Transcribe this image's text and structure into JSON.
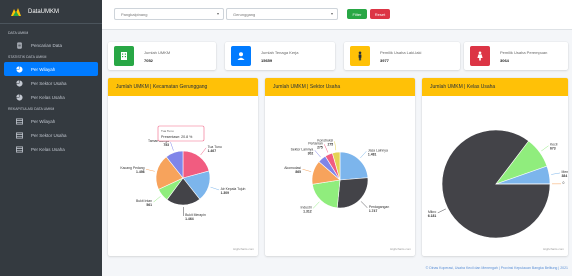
{
  "brand": {
    "name": "DataUMKM"
  },
  "sidebar": {
    "sections": [
      {
        "title": "DATA UMKM",
        "items": [
          {
            "label": "Pencarian Data",
            "icon": "file-icon"
          }
        ]
      },
      {
        "title": "STATISTIK DATA UMKM",
        "items": [
          {
            "label": "Per Wilayah",
            "icon": "pie-icon",
            "active": true
          },
          {
            "label": "Per Sektor Usaha",
            "icon": "pie-icon"
          },
          {
            "label": "Per Kelas Usaha",
            "icon": "pie-icon"
          }
        ]
      },
      {
        "title": "REKAPITULASI DATA UMKM",
        "items": [
          {
            "label": "Per Wilayah",
            "icon": "table-icon"
          },
          {
            "label": "Per Sektor Usaha",
            "icon": "table-icon"
          },
          {
            "label": "Per Kelas Usaha",
            "icon": "table-icon"
          }
        ]
      }
    ]
  },
  "filters": {
    "kabupaten": "Pangkalpinang",
    "kecamatan": "Gerunggang",
    "filter_label": "Filter",
    "reset_label": "Reset"
  },
  "cards": [
    {
      "label": "Jumlah UMKM",
      "value": "7052",
      "color": "#28a745",
      "icon": "building-icon"
    },
    {
      "label": "Jumlah Tenaga Kerja",
      "value": "15659",
      "color": "#007bff",
      "icon": "user-icon"
    },
    {
      "label": "Pemilik Usaha Laki-laki",
      "value": "3977",
      "color": "#ffc107",
      "icon": "male-icon"
    },
    {
      "label": "Pemilik Usaha Perempuan",
      "value": "3064",
      "color": "#dc3545",
      "icon": "female-icon"
    }
  ],
  "panels": [
    {
      "title": "Jumlah UMKM | Kecamatan Gerunggang"
    },
    {
      "title": "Jumlah UMKM | Sektor Usaha"
    },
    {
      "title": "Jumlah UMKM | Kelas Usaha"
    }
  ],
  "tooltip": {
    "title": "Tua Tunu",
    "text": "Presentase: 20.8 %"
  },
  "credits": "Highcharts.com",
  "footer": "© Dinas Koperasi, Usaha Kecil dan Menengah | Provinsi Kepulauan Bangka Belitung | 2021",
  "chart_data": [
    {
      "type": "pie",
      "title": "Jumlah UMKM | Kecamatan Gerunggang",
      "categories": [
        "Tua Tunu",
        "Air Kepala Tujuh",
        "Bukit Merapin",
        "Bukit Intan",
        "Kacang Pedang",
        "Taman Bunga"
      ],
      "values": [
        1467,
        1309,
        1464,
        561,
        1498,
        753
      ],
      "colors": [
        "#f15c80",
        "#7cb5ec",
        "#434348",
        "#90ed7d",
        "#f7a35c",
        "#8085e9"
      ],
      "labels": [
        "Tua Tunu\n1.467",
        "Air Kepala Tujuh\n1.309",
        "Bukit Merapin\n1.464",
        "Bukit Intan\n561",
        "Kacang Pedang\n1.498",
        "Taman Bunga\n753"
      ]
    },
    {
      "type": "pie",
      "title": "Jumlah UMKM | Sektor Usaha",
      "categories": [
        "Jasa Lainnya",
        "Perdagangan",
        "Industri",
        "Akomodasi",
        "Sektor Lainnya",
        "Pertanian",
        "Konstruksi"
      ],
      "values": [
        1481,
        1747,
        1312,
        865,
        302,
        275,
        275
      ],
      "colors": [
        "#7cb5ec",
        "#434348",
        "#90ed7d",
        "#f7a35c",
        "#8085e9",
        "#f15c80",
        "#e4d354"
      ],
      "labels": [
        "Jasa Lainnya\n1.481",
        "Perdagangan\n1.747",
        "Industri\n1.312",
        "Akomodasi\n865",
        "Sektor Lainnya\n302",
        "Pertanian\n275",
        "Konstruksi\n275"
      ]
    },
    {
      "type": "pie",
      "title": "Jumlah UMKM | Kelas Usaha",
      "categories": [
        "Mikro",
        "Kecil",
        "Menengah",
        "Besar"
      ],
      "values": [
        6181,
        673,
        384,
        5
      ],
      "colors": [
        "#434348",
        "#90ed7d",
        "#7cb5ec",
        "#f7a35c"
      ],
      "labels": [
        "Mikro\n6.181",
        "Kecil\n673",
        "Menengah\n384",
        "0"
      ]
    }
  ]
}
